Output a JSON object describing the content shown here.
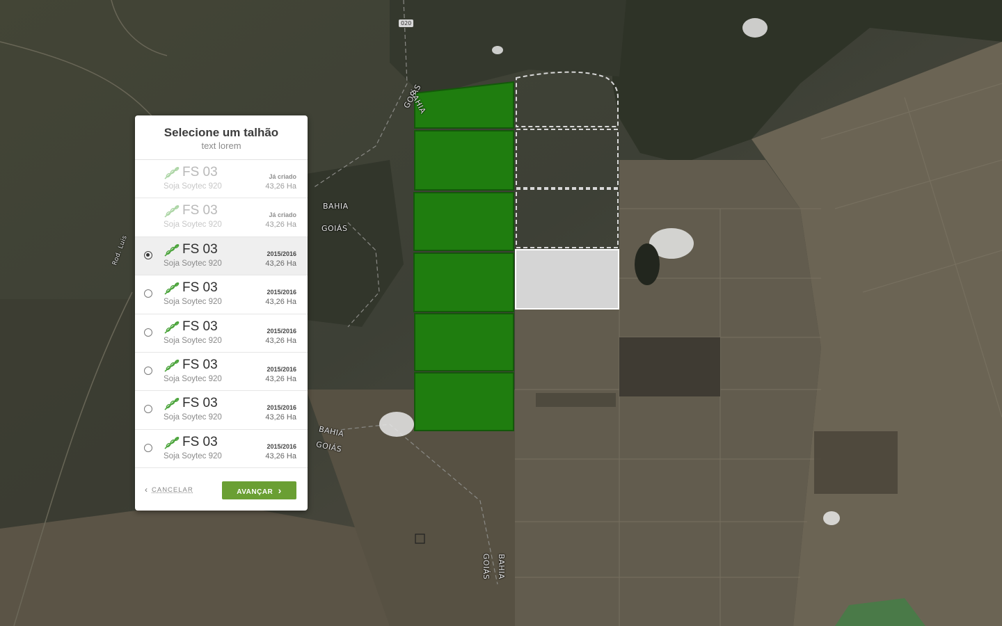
{
  "map": {
    "road_shield": "020",
    "labels": [
      {
        "id": "goias-bahia-top-1",
        "text": "GOIÁS"
      },
      {
        "id": "goias-bahia-top-2",
        "text": "BAHIA"
      },
      {
        "id": "bahia-mid",
        "text": "BAHIA"
      },
      {
        "id": "goias-mid",
        "text": "GOIÁS"
      },
      {
        "id": "bahia-low",
        "text": "BAHIA"
      },
      {
        "id": "goias-low",
        "text": "GOIÁS"
      },
      {
        "id": "goias-bottom",
        "text": "GOIÁS"
      },
      {
        "id": "bahia-bottom",
        "text": "BAHIA"
      },
      {
        "id": "rod",
        "text": "Rod. Luis"
      }
    ],
    "colors": {
      "field_green": "#1f7d0f",
      "field_selected": "#d5d5d5",
      "accent": "#6a9f33"
    }
  },
  "panel": {
    "title": "Selecione um talhão",
    "subtitle": "text lorem",
    "items": [
      {
        "name": "FS 03",
        "crop": "Soja Soytec 920",
        "season": "Já criado",
        "area": "43,26 Ha",
        "state": "done",
        "icon": "leaf-icon"
      },
      {
        "name": "FS 03",
        "crop": "Soja Soytec 920",
        "season": "Já criado",
        "area": "43,26 Ha",
        "state": "done",
        "icon": "leaf-icon"
      },
      {
        "name": "FS 03",
        "crop": "Soja Soytec 920",
        "season": "2015/2016",
        "area": "43,26 Ha",
        "state": "selected",
        "icon": "leaf-icon"
      },
      {
        "name": "FS 03",
        "crop": "Soja Soytec 920",
        "season": "2015/2016",
        "area": "43,26 Ha",
        "state": "available",
        "icon": "leaf-icon"
      },
      {
        "name": "FS 03",
        "crop": "Soja Soytec 920",
        "season": "2015/2016",
        "area": "43,26 Ha",
        "state": "available",
        "icon": "leaf-icon"
      },
      {
        "name": "FS 03",
        "crop": "Soja Soytec 920",
        "season": "2015/2016",
        "area": "43,26 Ha",
        "state": "available",
        "icon": "leaf-icon"
      },
      {
        "name": "FS 03",
        "crop": "Soja Soytec 920",
        "season": "2015/2016",
        "area": "43,26 Ha",
        "state": "available",
        "icon": "leaf-icon"
      },
      {
        "name": "FS 03",
        "crop": "Soja Soytec 920",
        "season": "2015/2016",
        "area": "43,26 Ha",
        "state": "available",
        "icon": "leaf-icon"
      }
    ],
    "cancel_label": "CANCELAR",
    "next_label": "AVANÇAR"
  }
}
